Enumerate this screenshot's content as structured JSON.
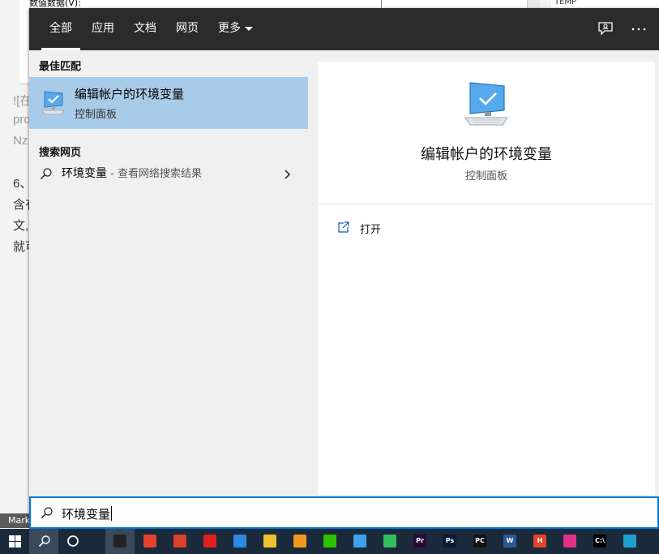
{
  "background": {
    "dialog_label": "数值数据(V):",
    "var_name": "TEMP",
    "text_lines": [
      "![在",
      "pro",
      "Nz",
      "6、",
      "含有",
      "文,",
      "就可"
    ],
    "mark_label": "Mark"
  },
  "tabs": [
    {
      "label": "全部",
      "active": true
    },
    {
      "label": "应用"
    },
    {
      "label": "文档"
    },
    {
      "label": "网页"
    },
    {
      "label": "更多"
    }
  ],
  "topbar_icons": [
    "feedback-icon",
    "more-icon"
  ],
  "best_match": {
    "section_title": "最佳匹配",
    "title": "编辑帐户的环境变量",
    "subtitle": "控制面板",
    "icon": "monitor-checkmark-icon"
  },
  "web_search": {
    "section_title": "搜索网页",
    "query": "环境变量",
    "hint": " - 查看网络搜索结果"
  },
  "preview": {
    "title": "编辑帐户的环境变量",
    "subtitle": "控制面板",
    "actions": [
      {
        "label": "打开",
        "icon": "open-icon"
      }
    ]
  },
  "search": {
    "value": "环境变量"
  },
  "taskbar": {
    "items": [
      {
        "name": "start-icon"
      },
      {
        "name": "search-icon"
      },
      {
        "name": "cortana-icon"
      },
      {
        "name": "qq-icon",
        "color": "#222222"
      },
      {
        "name": "chrome-icon",
        "color": "#e5412e"
      },
      {
        "name": "app-grid-icon",
        "color": "#d9412b"
      },
      {
        "name": "netease-music-icon",
        "color": "#e02020"
      },
      {
        "name": "app-blue-icon",
        "color": "#2a8ae0"
      },
      {
        "name": "file-explorer-icon",
        "color": "#f0c030"
      },
      {
        "name": "app-g-icon",
        "color": "#f09a20"
      },
      {
        "name": "wechat-icon",
        "color": "#2dc100"
      },
      {
        "name": "baidu-netdisk-icon",
        "color": "#3ea0f0"
      },
      {
        "name": "player-icon",
        "color": "#30c060"
      },
      {
        "name": "premiere-icon",
        "color": "#2a0a3a",
        "text": "Pr"
      },
      {
        "name": "photoshop-icon",
        "color": "#0a1a3a",
        "text": "Ps"
      },
      {
        "name": "pycharm-icon",
        "color": "#111111",
        "text": "PC"
      },
      {
        "name": "word-icon",
        "color": "#2b5797",
        "text": "W"
      },
      {
        "name": "app-h-icon",
        "color": "#e0452a",
        "text": "H"
      },
      {
        "name": "app-pointer-icon",
        "color": "#e0308a"
      },
      {
        "name": "cmd-icon",
        "color": "#000000",
        "text": "C:\\"
      },
      {
        "name": "app-grid-blue-icon",
        "color": "#20a0d0"
      }
    ]
  }
}
